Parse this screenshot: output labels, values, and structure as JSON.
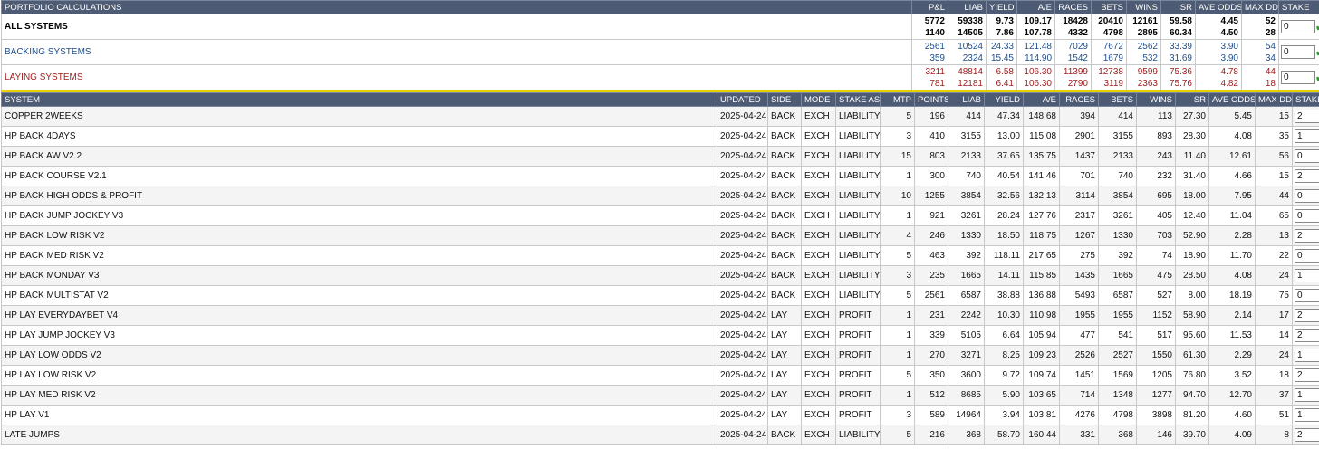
{
  "portfolio": {
    "title": "PORTFOLIO CALCULATIONS",
    "columns": [
      "P&L",
      "LIAB",
      "YIELD",
      "A/E",
      "RACES",
      "BETS",
      "WINS",
      "SR",
      "AVE ODDS",
      "MAX DD",
      "STAKE"
    ],
    "rows": [
      {
        "name": "ALL SYSTEMS",
        "line1": [
          "5772",
          "59338",
          "9.73",
          "109.17",
          "18428",
          "20410",
          "12161",
          "59.58",
          "4.45",
          "52"
        ],
        "line2": [
          "1140",
          "14505",
          "7.86",
          "107.78",
          "4332",
          "4798",
          "2895",
          "60.34",
          "4.50",
          "28"
        ],
        "stake": "0",
        "style": "all"
      },
      {
        "name": "BACKING SYSTEMS",
        "line1": [
          "2561",
          "10524",
          "24.33",
          "121.48",
          "7029",
          "7672",
          "2562",
          "33.39",
          "3.90",
          "54"
        ],
        "line2": [
          "359",
          "2324",
          "15.45",
          "114.90",
          "1542",
          "1679",
          "532",
          "31.69",
          "3.90",
          "34"
        ],
        "stake": "0",
        "style": "back"
      },
      {
        "name": "LAYING SYSTEMS",
        "line1": [
          "3211",
          "48814",
          "6.58",
          "106.30",
          "11399",
          "12738",
          "9599",
          "75.36",
          "4.78",
          "44"
        ],
        "line2": [
          "781",
          "12181",
          "6.41",
          "106.30",
          "2790",
          "3119",
          "2363",
          "75.76",
          "4.82",
          "18"
        ],
        "stake": "0",
        "style": "lay"
      }
    ]
  },
  "systems": {
    "columns": [
      "SYSTEM",
      "UPDATED",
      "SIDE",
      "MODE",
      "STAKE AS",
      "MTP",
      "POINTS",
      "LIAB",
      "YIELD",
      "A/E",
      "RACES",
      "BETS",
      "WINS",
      "SR",
      "AVE ODDS",
      "MAX DD",
      "STAKE"
    ],
    "rows": [
      [
        "COPPER 2WEEKS",
        "2025-04-24",
        "BACK",
        "EXCH",
        "LIABILITY",
        "5",
        "196",
        "414",
        "47.34",
        "148.68",
        "394",
        "414",
        "113",
        "27.30",
        "5.45",
        "15",
        "2"
      ],
      [
        "HP BACK 4DAYS",
        "2025-04-24",
        "BACK",
        "EXCH",
        "LIABILITY",
        "3",
        "410",
        "3155",
        "13.00",
        "115.08",
        "2901",
        "3155",
        "893",
        "28.30",
        "4.08",
        "35",
        "1"
      ],
      [
        "HP BACK AW V2.2",
        "2025-04-24",
        "BACK",
        "EXCH",
        "LIABILITY",
        "15",
        "803",
        "2133",
        "37.65",
        "135.75",
        "1437",
        "2133",
        "243",
        "11.40",
        "12.61",
        "56",
        "0"
      ],
      [
        "HP BACK COURSE V2.1",
        "2025-04-24",
        "BACK",
        "EXCH",
        "LIABILITY",
        "1",
        "300",
        "740",
        "40.54",
        "141.46",
        "701",
        "740",
        "232",
        "31.40",
        "4.66",
        "15",
        "2"
      ],
      [
        "HP BACK HIGH ODDS & PROFIT",
        "2025-04-24",
        "BACK",
        "EXCH",
        "LIABILITY",
        "10",
        "1255",
        "3854",
        "32.56",
        "132.13",
        "3114",
        "3854",
        "695",
        "18.00",
        "7.95",
        "44",
        "0"
      ],
      [
        "HP BACK JUMP JOCKEY V3",
        "2025-04-24",
        "BACK",
        "EXCH",
        "LIABILITY",
        "1",
        "921",
        "3261",
        "28.24",
        "127.76",
        "2317",
        "3261",
        "405",
        "12.40",
        "11.04",
        "65",
        "0"
      ],
      [
        "HP BACK LOW RISK V2",
        "2025-04-24",
        "BACK",
        "EXCH",
        "LIABILITY",
        "4",
        "246",
        "1330",
        "18.50",
        "118.75",
        "1267",
        "1330",
        "703",
        "52.90",
        "2.28",
        "13",
        "2"
      ],
      [
        "HP BACK MED RISK V2",
        "2025-04-24",
        "BACK",
        "EXCH",
        "LIABILITY",
        "5",
        "463",
        "392",
        "118.11",
        "217.65",
        "275",
        "392",
        "74",
        "18.90",
        "11.70",
        "22",
        "0"
      ],
      [
        "HP BACK MONDAY V3",
        "2025-04-24",
        "BACK",
        "EXCH",
        "LIABILITY",
        "3",
        "235",
        "1665",
        "14.11",
        "115.85",
        "1435",
        "1665",
        "475",
        "28.50",
        "4.08",
        "24",
        "1"
      ],
      [
        "HP BACK MULTISTAT V2",
        "2025-04-24",
        "BACK",
        "EXCH",
        "LIABILITY",
        "5",
        "2561",
        "6587",
        "38.88",
        "136.88",
        "5493",
        "6587",
        "527",
        "8.00",
        "18.19",
        "75",
        "0"
      ],
      [
        "HP LAY EVERYDAYBET V4",
        "2025-04-24",
        "LAY",
        "EXCH",
        "PROFIT",
        "1",
        "231",
        "2242",
        "10.30",
        "110.98",
        "1955",
        "1955",
        "1152",
        "58.90",
        "2.14",
        "17",
        "2"
      ],
      [
        "HP LAY JUMP JOCKEY V3",
        "2025-04-24",
        "LAY",
        "EXCH",
        "PROFIT",
        "1",
        "339",
        "5105",
        "6.64",
        "105.94",
        "477",
        "541",
        "517",
        "95.60",
        "11.53",
        "14",
        "2"
      ],
      [
        "HP LAY LOW ODDS V2",
        "2025-04-24",
        "LAY",
        "EXCH",
        "PROFIT",
        "1",
        "270",
        "3271",
        "8.25",
        "109.23",
        "2526",
        "2527",
        "1550",
        "61.30",
        "2.29",
        "24",
        "1"
      ],
      [
        "HP LAY LOW RISK V2",
        "2025-04-24",
        "LAY",
        "EXCH",
        "PROFIT",
        "5",
        "350",
        "3600",
        "9.72",
        "109.74",
        "1451",
        "1569",
        "1205",
        "76.80",
        "3.52",
        "18",
        "2"
      ],
      [
        "HP LAY MED RISK V2",
        "2025-04-24",
        "LAY",
        "EXCH",
        "PROFIT",
        "1",
        "512",
        "8685",
        "5.90",
        "103.65",
        "714",
        "1348",
        "1277",
        "94.70",
        "12.70",
        "37",
        "1"
      ],
      [
        "HP LAY V1",
        "2025-04-24",
        "LAY",
        "EXCH",
        "PROFIT",
        "3",
        "589",
        "14964",
        "3.94",
        "103.81",
        "4276",
        "4798",
        "3898",
        "81.20",
        "4.60",
        "51",
        "1"
      ],
      [
        "LATE JUMPS",
        "2025-04-24",
        "BACK",
        "EXCH",
        "LIABILITY",
        "5",
        "216",
        "368",
        "58.70",
        "160.44",
        "331",
        "368",
        "146",
        "39.70",
        "4.09",
        "8",
        "2"
      ]
    ]
  },
  "icons": {
    "confirm": "check-icon",
    "remove": "x-icon"
  }
}
